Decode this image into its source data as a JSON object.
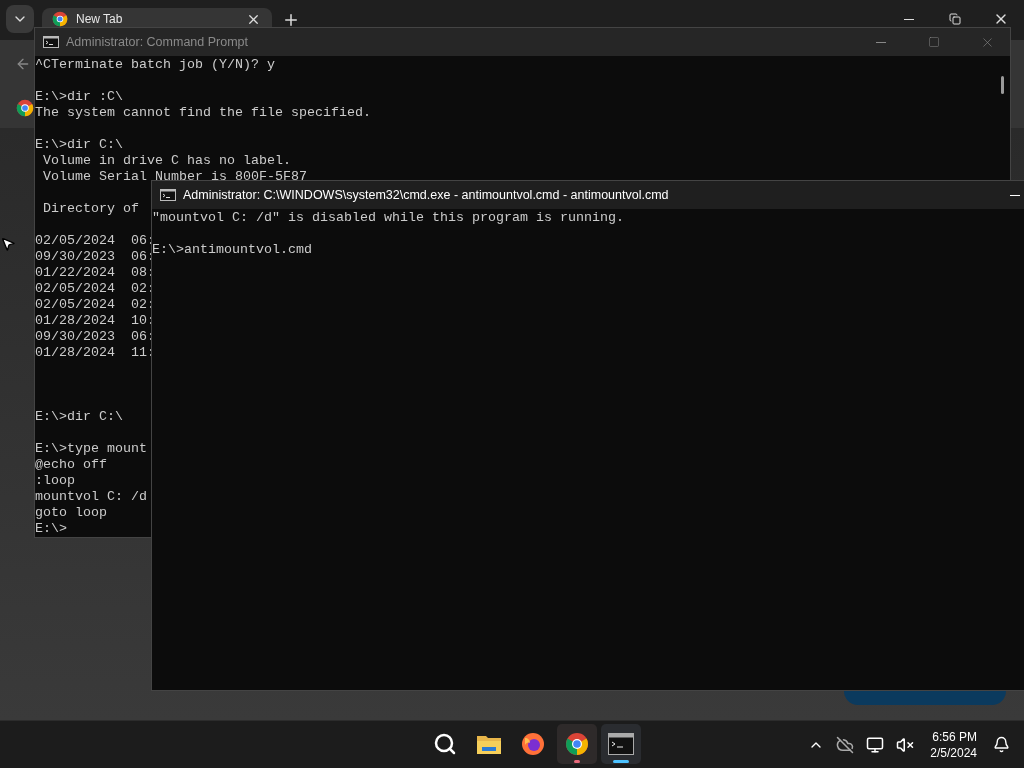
{
  "browser": {
    "tabs": [
      {
        "title": "New Tab",
        "selected": true
      }
    ]
  },
  "windows": [
    {
      "title": "Administrator: Command Prompt",
      "active": false,
      "lines": [
        {
          "kind": "text",
          "text": "^CTerminate batch job (Y/N)? y"
        },
        {
          "kind": "blank"
        },
        {
          "kind": "text",
          "text": "E:\\>dir :C\\"
        },
        {
          "kind": "text",
          "text": "The system cannot find the file specified."
        },
        {
          "kind": "blank"
        },
        {
          "kind": "text",
          "text": "E:\\>dir C:\\"
        },
        {
          "kind": "text",
          "text": " Volume in drive C has no label."
        },
        {
          "kind": "text",
          "text": " Volume Serial Number is 800F-5F87"
        },
        {
          "kind": "blank"
        },
        {
          "kind": "text",
          "text": " Directory of "
        },
        {
          "kind": "blank"
        },
        {
          "kind": "text",
          "text": "02/05/2024  06:"
        },
        {
          "kind": "text",
          "text": "09/30/2023  06:"
        },
        {
          "kind": "text",
          "text": "01/22/2024  08:"
        },
        {
          "kind": "text",
          "text": "02/05/2024  02:"
        },
        {
          "kind": "text",
          "text": "02/05/2024  02:"
        },
        {
          "kind": "text",
          "text": "01/28/2024  10:"
        },
        {
          "kind": "text",
          "text": "09/30/2023  06:"
        },
        {
          "kind": "text",
          "text": "01/28/2024  11:"
        },
        {
          "kind": "blank"
        },
        {
          "kind": "blank"
        },
        {
          "kind": "blank"
        },
        {
          "kind": "text",
          "text": "E:\\>dir C:\\"
        },
        {
          "kind": "blank"
        },
        {
          "kind": "text",
          "text": "E:\\>type mount"
        },
        {
          "kind": "text",
          "text": "@echo off"
        },
        {
          "kind": "text",
          "text": ":loop"
        },
        {
          "kind": "text",
          "text": "mountvol C: /d"
        },
        {
          "kind": "text",
          "text": "goto loop"
        },
        {
          "kind": "text",
          "text": "E:\\>"
        }
      ]
    },
    {
      "title": "Administrator: C:\\WINDOWS\\system32\\cmd.exe - antimountvol.cmd - antimountvol.cmd",
      "active": true,
      "lines": [
        {
          "kind": "text",
          "text": "\"mountvol C: /d\" is disabled while this program is running."
        },
        {
          "kind": "blank"
        },
        {
          "kind": "text",
          "text": "E:\\>antimountvol.cmd"
        }
      ]
    }
  ],
  "taskbar": {
    "apps": [
      {
        "kind": "search",
        "running": false,
        "focused": false
      },
      {
        "kind": "files",
        "running": false,
        "focused": false
      },
      {
        "kind": "firefox",
        "running": false,
        "focused": false
      },
      {
        "kind": "chrome",
        "running": true,
        "focused": false
      },
      {
        "kind": "terminal",
        "running": true,
        "focused": true
      }
    ],
    "time": "6:56 PM",
    "date": "2/5/2024"
  }
}
